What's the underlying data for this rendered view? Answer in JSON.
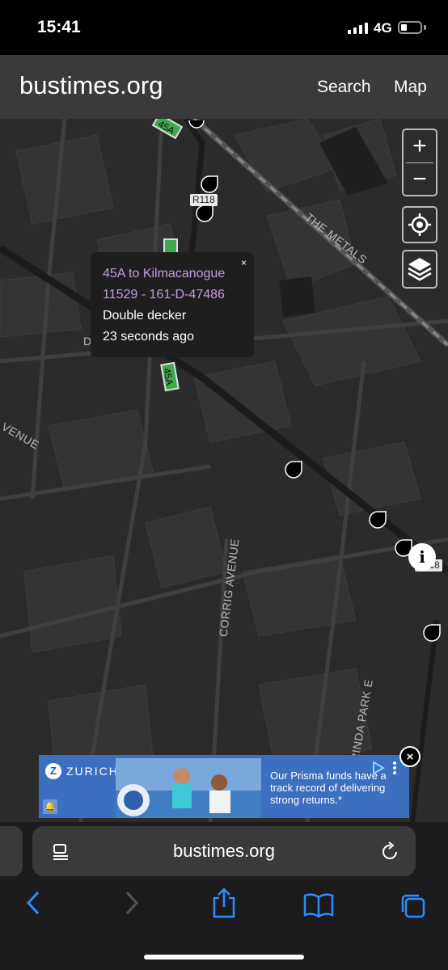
{
  "status_bar": {
    "time": "15:41",
    "network": "4G",
    "battery_level": 0.3
  },
  "header": {
    "brand": "bustimes.org",
    "search_label": "Search",
    "map_label": "Map"
  },
  "map": {
    "zoom_in_label": "+",
    "zoom_out_label": "−",
    "road_labels": [
      "R118",
      "R118"
    ],
    "street_labels": [
      "THE METALS",
      "CORRIG AVENUE",
      "LARINDA PARK E",
      "VENUE",
      "D"
    ],
    "bus_markers": [
      "45A",
      "45A"
    ],
    "popup": {
      "close_label": "×",
      "route": "45A to Kilmacanogue",
      "vehicle": "11529 - 161-D-47486",
      "type": "Double decker",
      "updated": "23 seconds ago"
    },
    "info_label": "i"
  },
  "ad": {
    "brand": "ZURICH",
    "logo_letter": "Z",
    "copy": "Our Prisma funds have a track record of delivering strong returns.*",
    "close_label": "×"
  },
  "browser": {
    "url": "bustimes.org"
  },
  "colors": {
    "accent_link": "#2f8cff",
    "popup_route": "#c79be0",
    "bus_marker": "#3ea84e"
  }
}
